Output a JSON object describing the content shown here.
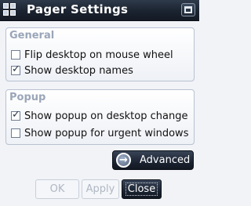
{
  "window": {
    "title": "Pager Settings",
    "icons": {
      "app": "grid-icon",
      "maximize": "maximize-icon"
    }
  },
  "general": {
    "heading": "General",
    "options": [
      {
        "label": "Flip desktop on mouse wheel",
        "checked": false
      },
      {
        "label": "Show desktop names",
        "checked": true
      }
    ]
  },
  "popup": {
    "heading": "Popup",
    "options": [
      {
        "label": "Show popup on desktop change",
        "checked": true
      },
      {
        "label": "Show popup for urgent windows",
        "checked": false
      }
    ]
  },
  "buttons": {
    "advanced": "Advanced",
    "ok": "OK",
    "apply": "Apply",
    "close": "Close"
  },
  "colors": {
    "titlebar": "#1b2330",
    "frame_heading": "#9aa6b8",
    "background": "#f1f3f7"
  }
}
